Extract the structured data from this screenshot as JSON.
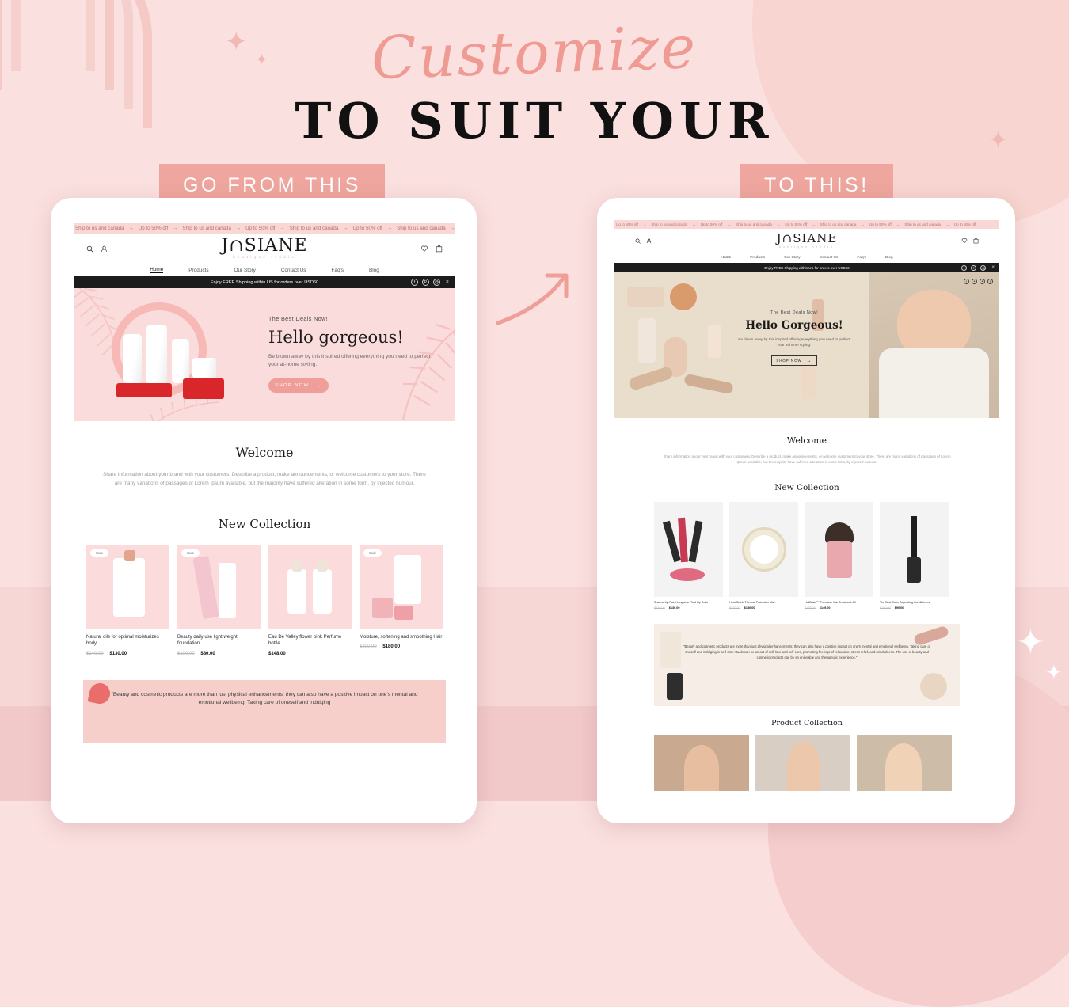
{
  "poster": {
    "script_headline": "Customize",
    "serif_headline": "TO SUIT YOUR",
    "badge_left": "GO FROM THIS",
    "badge_right": "TO THIS!",
    "accent_pink": "#eea69e",
    "bg_pink": "#fbe0e0",
    "band_pink": "#f7d6d6"
  },
  "site": {
    "announcement": {
      "items": [
        "Up to 50% off",
        "Ship to us and canada",
        "Up to 50% off",
        "Ship to us and canada",
        "Up to 50% off",
        "Ship to us and canada",
        "Up to 50% off",
        "Ship to us and canada",
        "Up to 50% off"
      ],
      "separator": "→"
    },
    "brand": {
      "name": "J∩SIANE",
      "tagline": "boutique studio"
    },
    "header_icons_left": [
      "search-icon",
      "account-icon"
    ],
    "header_icons_right": [
      "wishlist-heart-icon",
      "cart-bag-icon"
    ],
    "nav": [
      {
        "label": "Home",
        "active": true
      },
      {
        "label": "Products",
        "active": false
      },
      {
        "label": "Our Story",
        "active": false
      },
      {
        "label": "Contact Us",
        "active": false
      },
      {
        "label": "Faq's",
        "active": false
      },
      {
        "label": "Blog",
        "active": false
      }
    ],
    "shipping_bar": {
      "text": "Enjoy FREE Shipping within US for orders over USD60",
      "socials": [
        "f",
        "P",
        "@"
      ],
      "close": "×"
    }
  },
  "left_theme": {
    "hero": {
      "eyebrow": "The Best Deals Now!",
      "title": "Hello gorgeous!",
      "subtitle": "Be blown away by this inspired offering everything you need to perfect your at-home styling.",
      "cta": "SHOP NOW",
      "cta_icon": "arrow-right-icon"
    },
    "welcome": {
      "title": "Welcome",
      "body": "Share information about your brand with your customers. Describe a product, make announcements, or welcome customers to your store. There are many variations of passages of Lorem Ipsum available, but the majority have suffered alteration in some form, by injected humour."
    },
    "collection": {
      "title": "New Collection",
      "sale_badge": "Sale",
      "products": [
        {
          "name": "Natural oils for optimal moisturizes body",
          "old_price": "$140.00",
          "price": "$130.00",
          "badge": true
        },
        {
          "name": "Beauty daily use light weight foundation",
          "old_price": "$100.00",
          "price": "$80.00",
          "badge": true
        },
        {
          "name": "Eau De Valley flower pink Perfume bottle",
          "old_price": "",
          "price": "$148.00",
          "badge": false
        },
        {
          "name": "Moisture, softening and smoothing Hair",
          "old_price": "$200.00",
          "price": "$180.00",
          "badge": true
        }
      ]
    },
    "quote": "\"Beauty and cosmetic products are more than just physical enhancements; they can also have a positive impact on one's mental and emotional wellbeing. Taking care of oneself and indulging"
  },
  "right_theme": {
    "hero": {
      "eyebrow": "The Best Deals Now!",
      "title": "Hello Gorgeous!",
      "subtitle": "Be blown away by this inspired offeringeverything you need to perfect your at-home styling.",
      "cta": "SHOP NOW",
      "cta_icon": "arrow-right-icon",
      "carousel_dots": [
        "‹",
        "•",
        "•",
        "›"
      ]
    },
    "welcome": {
      "title": "Welcome",
      "body": "Share information about your brand with your customers. Describe a product, make announcements, or welcome customers to your store. There are many variations of passages of Lorem Ipsum available, but the majority have suffered alteration in some form, by injected humour."
    },
    "collection": {
      "title": "New Collection",
      "products": [
        {
          "name": "Sharma Lip Paint Longwear Fluid Lip Color",
          "old_price": "$149.00",
          "price": "$130.00"
        },
        {
          "name": "Heat Shield Thermal Protection Mist",
          "old_price": "$200.00",
          "price": "$180.00"
        },
        {
          "name": "HaliBasix™ Pre-wash Hair Treatment Oil",
          "old_price": "$179.00",
          "price": "$149.00"
        },
        {
          "name": "The Best Color Depositing Conditioners",
          "old_price": "$100.00",
          "price": "$90.00"
        }
      ]
    },
    "quote": "\"Beauty and cosmetic products are more than just physical enhancements; they can also have a positive impact on one's mental and emotional wellbeing. Taking care of oneself and indulging in self-care rituals can be an act of self-love and self-care, promoting feelings of relaxation, stress relief, and mindfulness. The use of beauty and cosmetic products can be an enjoyable and therapeutic experience.\"",
    "product_collection": {
      "title": "Product Collection"
    }
  }
}
